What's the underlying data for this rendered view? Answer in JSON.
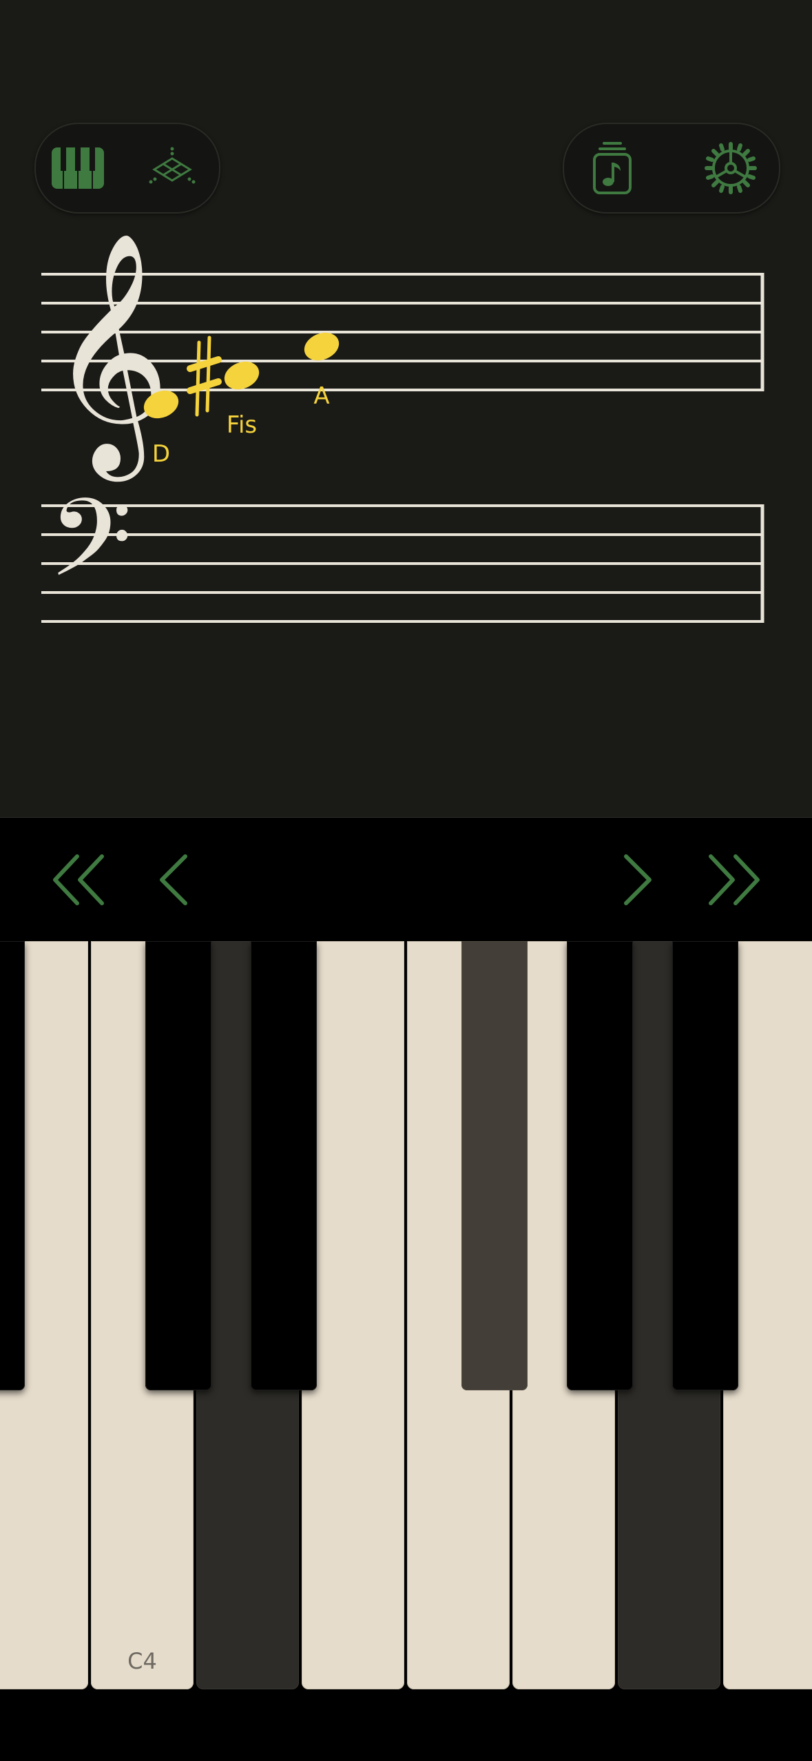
{
  "toolbar": {
    "left": [
      {
        "name": "piano-keyboard-icon",
        "active": true
      },
      {
        "name": "diamond-lattice-icon",
        "active": false
      }
    ],
    "right": [
      {
        "name": "music-note-jar-icon"
      },
      {
        "name": "gear-icon"
      }
    ]
  },
  "staff": {
    "treble_notes": [
      {
        "label": "D",
        "accidental": ""
      },
      {
        "label": "Fis",
        "accidental": "sharp"
      },
      {
        "label": "A",
        "accidental": ""
      }
    ]
  },
  "navigation": {
    "items": [
      "skip-back-icon",
      "back-icon",
      "forward-icon",
      "skip-forward-icon"
    ]
  },
  "keyboard": {
    "c4_label": "C4",
    "pressed_white_keys": [
      "D4",
      "A4"
    ],
    "pressed_black_keys": [
      "F#4"
    ]
  },
  "colors": {
    "background": "#1a1a17",
    "accent_green": "#3f7a41",
    "note_yellow": "#f5d33c",
    "staff_line": "#e9e4d8",
    "white_key": "#e6dccb",
    "pressed_white_key": "#2e2c28",
    "pressed_black_key": "#433f38"
  }
}
